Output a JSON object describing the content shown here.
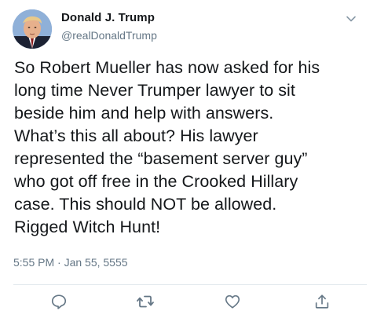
{
  "tweet": {
    "author_name": "Donald J. Trump",
    "author_handle": "@realDonaldTrump",
    "text": "So Robert Mueller has now asked for his\nlong time Never Trumper lawyer to sit\nbeside him and help with answers.\nWhat’s this all about? His lawyer\nrepresented the “basement server guy”\nwho got off free in the Crooked Hillary\ncase. This should NOT be allowed.\nRigged Witch Hunt!",
    "timestamp": "5:55 PM · Jan 55, 5555"
  },
  "icons": {
    "menu": "chevron-down-icon",
    "reply": "reply-icon",
    "retweet": "retweet-icon",
    "like": "heart-icon",
    "share": "share-icon"
  },
  "colors": {
    "text": "#14171a",
    "secondary": "#657786",
    "icon": "#657786",
    "divider": "#e1e8ed"
  }
}
